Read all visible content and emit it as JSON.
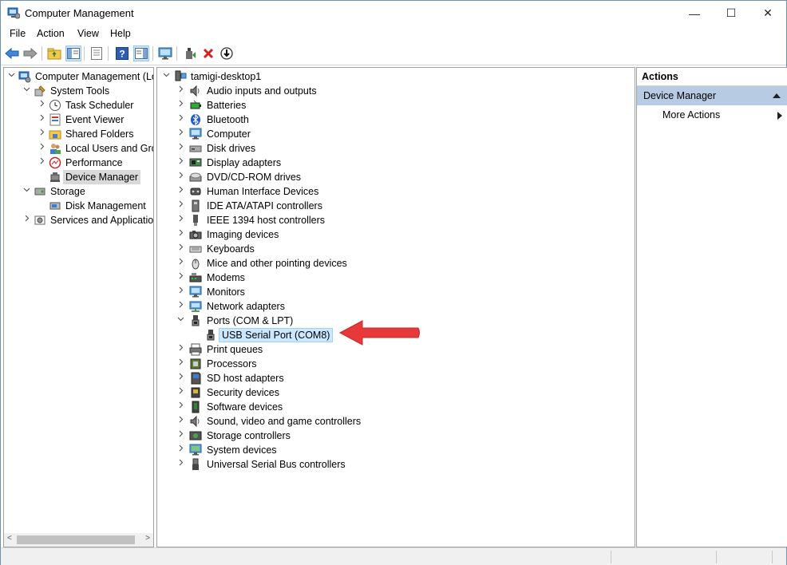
{
  "window": {
    "title": "Computer Management",
    "controls": {
      "minimize": "—",
      "maximize": "☐",
      "close": "✕"
    }
  },
  "menu": [
    "File",
    "Action",
    "View",
    "Help"
  ],
  "toolbar": {
    "icons": [
      "back-arrow-icon",
      "forward-arrow-icon",
      "up-folder-icon",
      "show-hide-tree-icon",
      "properties-icon",
      "help-icon",
      "action-pane-icon",
      "monitor-icon",
      "update-driver-icon",
      "uninstall-icon",
      "disable-device-icon"
    ]
  },
  "left_tree": [
    {
      "label": "Computer Management (Local",
      "level": 0,
      "expander": "expanded",
      "icon": "computer-management-icon"
    },
    {
      "label": "System Tools",
      "level": 1,
      "expander": "expanded",
      "icon": "system-tools-icon"
    },
    {
      "label": "Task Scheduler",
      "level": 2,
      "expander": "collapsed",
      "icon": "clock-icon"
    },
    {
      "label": "Event Viewer",
      "level": 2,
      "expander": "collapsed",
      "icon": "event-viewer-icon"
    },
    {
      "label": "Shared Folders",
      "level": 2,
      "expander": "collapsed",
      "icon": "shared-folders-icon"
    },
    {
      "label": "Local Users and Groups",
      "level": 2,
      "expander": "collapsed",
      "icon": "users-icon"
    },
    {
      "label": "Performance",
      "level": 2,
      "expander": "collapsed",
      "icon": "performance-icon"
    },
    {
      "label": "Device Manager",
      "level": 2,
      "expander": "none",
      "icon": "device-manager-icon",
      "selected": true
    },
    {
      "label": "Storage",
      "level": 1,
      "expander": "expanded",
      "icon": "storage-icon"
    },
    {
      "label": "Disk Management",
      "level": 2,
      "expander": "none",
      "icon": "disk-management-icon"
    },
    {
      "label": "Services and Applications",
      "level": 1,
      "expander": "collapsed",
      "icon": "services-icon"
    }
  ],
  "device_tree": {
    "root": "tamigi-desktop1",
    "categories": [
      {
        "label": "Audio inputs and outputs",
        "icon": "speaker-icon"
      },
      {
        "label": "Batteries",
        "icon": "battery-icon"
      },
      {
        "label": "Bluetooth",
        "icon": "bluetooth-icon"
      },
      {
        "label": "Computer",
        "icon": "monitor-icon"
      },
      {
        "label": "Disk drives",
        "icon": "disk-drive-icon"
      },
      {
        "label": "Display adapters",
        "icon": "display-adapter-icon"
      },
      {
        "label": "DVD/CD-ROM drives",
        "icon": "dvd-drive-icon"
      },
      {
        "label": "Human Interface Devices",
        "icon": "hid-icon"
      },
      {
        "label": "IDE ATA/ATAPI controllers",
        "icon": "ide-controller-icon"
      },
      {
        "label": "IEEE 1394 host controllers",
        "icon": "ieee1394-icon"
      },
      {
        "label": "Imaging devices",
        "icon": "camera-icon"
      },
      {
        "label": "Keyboards",
        "icon": "keyboard-icon"
      },
      {
        "label": "Mice and other pointing devices",
        "icon": "mouse-icon"
      },
      {
        "label": "Modems",
        "icon": "modem-icon"
      },
      {
        "label": "Monitors",
        "icon": "monitor-icon"
      },
      {
        "label": "Network adapters",
        "icon": "network-adapter-icon"
      },
      {
        "label": "Ports (COM & LPT)",
        "icon": "port-icon",
        "expanded": true,
        "children": [
          {
            "label": "USB Serial Port (COM8)",
            "icon": "port-icon",
            "selected": true
          }
        ]
      },
      {
        "label": "Print queues",
        "icon": "printer-icon"
      },
      {
        "label": "Processors",
        "icon": "processor-icon"
      },
      {
        "label": "SD host adapters",
        "icon": "sd-card-icon"
      },
      {
        "label": "Security devices",
        "icon": "security-device-icon"
      },
      {
        "label": "Software devices",
        "icon": "software-device-icon"
      },
      {
        "label": "Sound, video and game controllers",
        "icon": "speaker-icon"
      },
      {
        "label": "Storage controllers",
        "icon": "storage-controller-icon"
      },
      {
        "label": "System devices",
        "icon": "system-devices-icon"
      },
      {
        "label": "Universal Serial Bus controllers",
        "icon": "usb-icon"
      }
    ]
  },
  "actions": {
    "header": "Actions",
    "section": "Device Manager",
    "items": [
      "More Actions"
    ]
  },
  "annotation": {
    "pointer_color": "#e8393a"
  }
}
